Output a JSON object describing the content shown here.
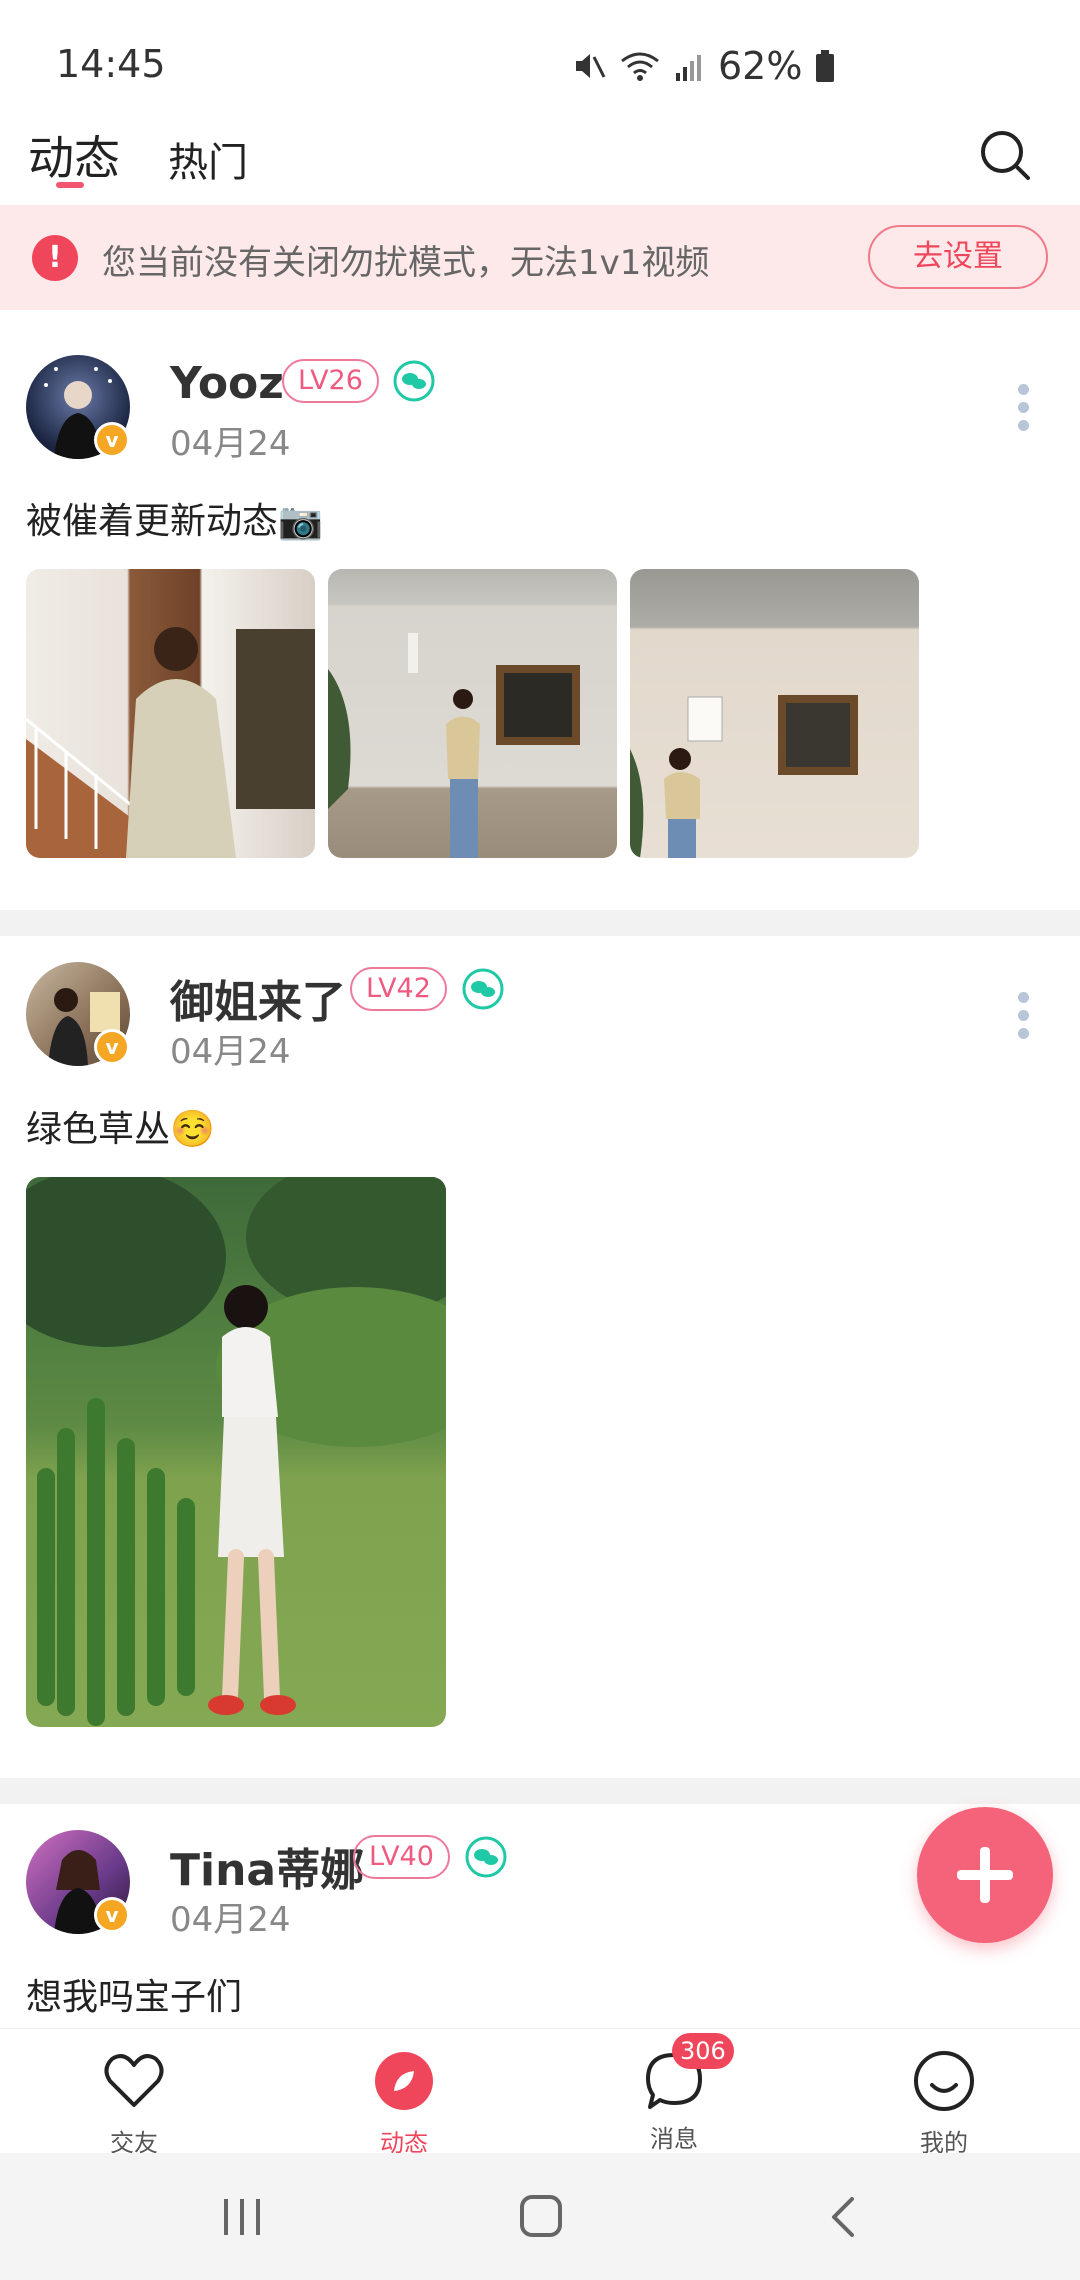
{
  "status": {
    "time": "14:45",
    "battery": "62%"
  },
  "tabs": {
    "active": "动态",
    "hot": "热门"
  },
  "alert": {
    "text": "您当前没有关闭勿扰模式，无法1v1视频",
    "button": "去设置"
  },
  "posts": [
    {
      "username": "Yooz",
      "level": "LV26",
      "date": "04月24",
      "text": "被催着更新动态📷"
    },
    {
      "username": "御姐来了",
      "level": "LV42",
      "date": "04月24",
      "text": "绿色草丛☺️"
    },
    {
      "username": "Tina蒂娜",
      "level": "LV40",
      "date": "04月24",
      "text": "想我吗宝子们"
    }
  ],
  "bottom_nav": {
    "items": [
      {
        "label": "交友",
        "icon": "heart-icon"
      },
      {
        "label": "动态",
        "icon": "compass-icon"
      },
      {
        "label": "消息",
        "icon": "chat-icon",
        "badge": "306"
      },
      {
        "label": "我的",
        "icon": "smile-icon"
      }
    ]
  },
  "colors": {
    "accent": "#f0465b",
    "alert_bg": "#fde9ea",
    "wechat": "#1fc9a6",
    "vip": "#f5a623"
  }
}
